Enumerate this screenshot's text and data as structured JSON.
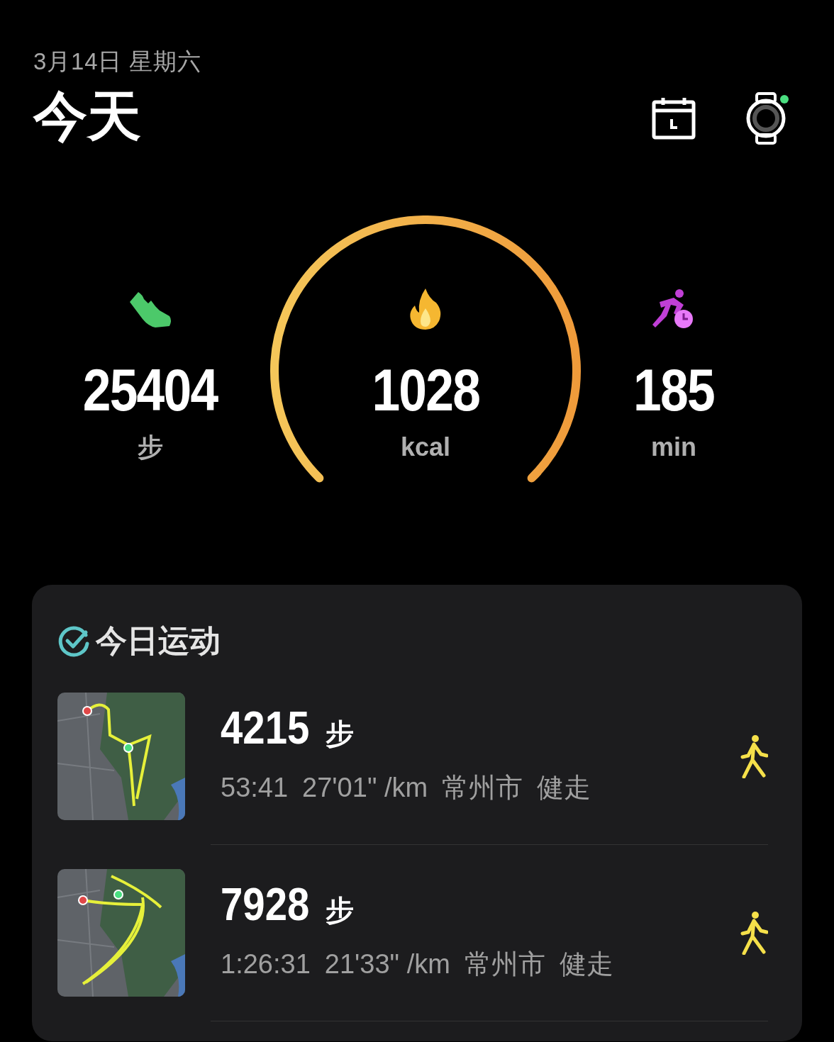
{
  "header": {
    "date": "3月14日 星期六",
    "title": "今天",
    "watch_connected": true
  },
  "stats": [
    {
      "kind": "steps",
      "value": "25404",
      "unit": "步"
    },
    {
      "kind": "calories",
      "value": "1028",
      "unit": "kcal"
    },
    {
      "kind": "minutes",
      "value": "185",
      "unit": "min"
    }
  ],
  "activity_card": {
    "title": "今日运动",
    "workouts": [
      {
        "steps": "4215",
        "steps_unit": "步",
        "duration": "53:41",
        "pace": "27'01\" /km",
        "location": "常州市",
        "sport": "健走"
      },
      {
        "steps": "7928",
        "steps_unit": "步",
        "duration": "1:26:31",
        "pace": "21'33\" /km",
        "location": "常州市",
        "sport": "健走"
      }
    ]
  }
}
